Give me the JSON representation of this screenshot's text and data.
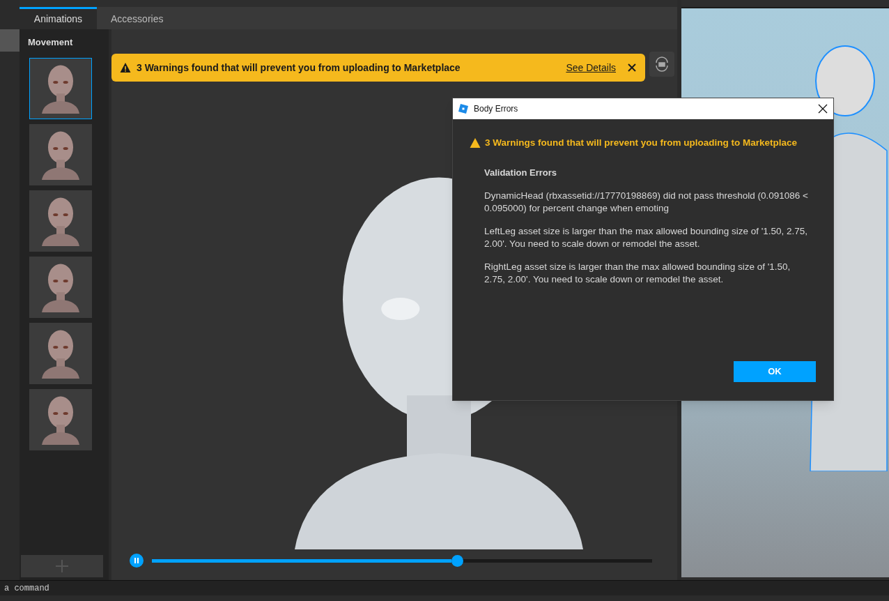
{
  "tabs": [
    {
      "label": "Animations",
      "selected": true
    },
    {
      "label": "Accessories",
      "selected": false
    }
  ],
  "section_title": "Movement",
  "animations": [
    {
      "selected": true
    },
    {
      "selected": false
    },
    {
      "selected": false
    },
    {
      "selected": false
    },
    {
      "selected": false
    },
    {
      "selected": false
    }
  ],
  "banner": {
    "message": "3 Warnings found that will prevent you from uploading to Marketplace",
    "link": "See Details"
  },
  "playback": {
    "playing": true,
    "level": 0.61
  },
  "dialog": {
    "title": "Body Errors",
    "warning": "3 Warnings found that will prevent you from uploading to Marketplace",
    "heading": "Validation Errors",
    "errors": [
      "DynamicHead (rbxassetid://17770198869) did not pass threshold (0.091086 < 0.095000) for percent change when emoting",
      "LeftLeg asset size is larger than the max allowed bounding size of '1.50, 2.75, 2.00'. You need to scale down or remodel the asset.",
      "RightLeg asset size is larger than the max allowed bounding size of '1.50, 2.75, 2.00'. You need to scale down or remodel the asset."
    ],
    "button": "OK"
  },
  "command_bar": {
    "placeholder": "a command"
  }
}
